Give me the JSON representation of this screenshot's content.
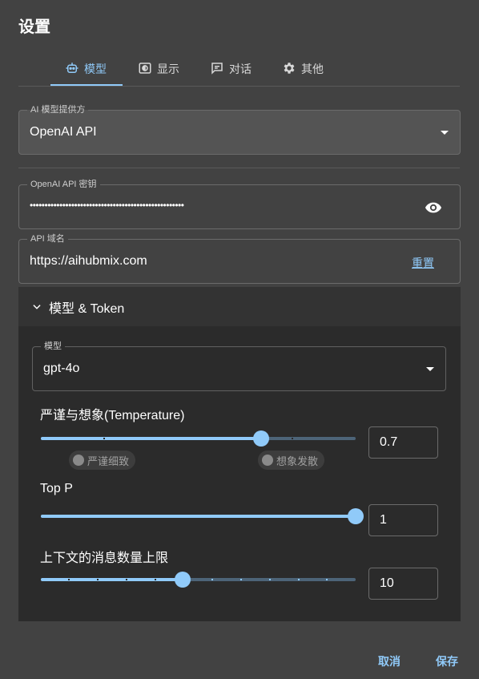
{
  "dialog": {
    "title": "设置"
  },
  "tabs": [
    {
      "label": "模型",
      "icon": "robot-icon",
      "active": true
    },
    {
      "label": "显示",
      "icon": "display-icon",
      "active": false
    },
    {
      "label": "对话",
      "icon": "chat-icon",
      "active": false
    },
    {
      "label": "其他",
      "icon": "gear-icon",
      "active": false
    }
  ],
  "provider": {
    "label": "AI 模型提供方",
    "value": "OpenAI API"
  },
  "api_key": {
    "label": "OpenAI API 密钥",
    "value": "••••••••••••••••••••••••••••••••••••••••••••••••••••"
  },
  "api_host": {
    "label": "API 域名",
    "value": "https://aihubmix.com",
    "reset_label": "重置"
  },
  "accordion": {
    "title": "模型 & Token",
    "model": {
      "label": "模型",
      "value": "gpt-4o"
    },
    "temperature": {
      "label": "严谨与想象(Temperature)",
      "value": "0.7",
      "fraction": 0.7,
      "min_chip": "严谨细致",
      "max_chip": "想象发散"
    },
    "top_p": {
      "label": "Top P",
      "value": "1",
      "fraction": 1.0
    },
    "context_limit": {
      "label": "上下文的消息数量上限",
      "value": "10",
      "fraction": 0.45
    }
  },
  "footer": {
    "cancel_label": "取消",
    "save_label": "保存"
  },
  "colors": {
    "accent": "#90caf9",
    "background": "#424242",
    "panel": "#2b2b2b"
  }
}
